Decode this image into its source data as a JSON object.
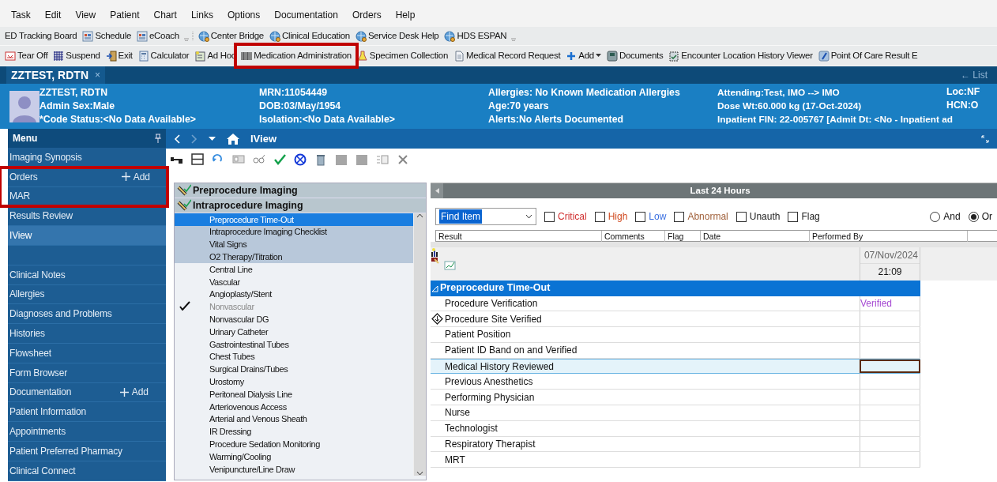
{
  "menu_bar": [
    "Task",
    "Edit",
    "View",
    "Patient",
    "Chart",
    "Links",
    "Options",
    "Documentation",
    "Orders",
    "Help"
  ],
  "toolbar_1": [
    {
      "label": "ED Tracking Board"
    },
    {
      "label": "Schedule"
    },
    {
      "label": "eCoach"
    },
    {
      "label": "Center Bridge"
    },
    {
      "label": "Clinical Education"
    },
    {
      "label": "Service Desk Help"
    },
    {
      "label": "HDS ESPAN"
    }
  ],
  "toolbar_2": [
    {
      "label": "Tear Off"
    },
    {
      "label": "Suspend"
    },
    {
      "label": "Exit"
    },
    {
      "label": "Calculator"
    },
    {
      "label": "Ad Hoc"
    },
    {
      "label": "Medication Administration",
      "highlighted": true
    },
    {
      "label": "Specimen Collection"
    },
    {
      "label": "Medical Record Request"
    },
    {
      "label": "Add"
    },
    {
      "label": "Documents"
    },
    {
      "label": "Encounter Location History Viewer"
    },
    {
      "label": "Point Of Care Result E"
    }
  ],
  "patient_tab": {
    "label": "ZZTEST, RDTN",
    "close": "×"
  },
  "list_button": {
    "arrow": "←",
    "label": "List"
  },
  "banner": [
    [
      "ZZTEST, RDTN",
      "Admin Sex:Male",
      "*Code Status:<No Data Available>"
    ],
    [
      "MRN:11054449",
      "DOB:03/May/1954",
      "Isolation:<No Data Available>"
    ],
    [
      "Allergies: No Known Medication Allergies",
      "Age:70 years",
      "Alerts:No Alerts Documented"
    ],
    [
      "Attending:Test, IMO --> IMO",
      "Dose Wt:60.000 kg (17-Oct-2024)",
      "Inpatient FIN: 22-005767 [Admit Dt: <No - Inpatient ad"
    ],
    [
      "Loc:NF",
      "HCN:O"
    ]
  ],
  "menu": {
    "title": "Menu",
    "items": [
      {
        "label": "Imaging Synopsis",
        "selected": false
      },
      {
        "label": "Orders",
        "add": "Add",
        "selected": false,
        "highlighted": true
      },
      {
        "label": "MAR",
        "selected": false,
        "highlighted": true
      },
      {
        "label": "Results Review",
        "selected": false
      },
      {
        "label": "IView",
        "selected": true,
        "spacer_after": true
      },
      {
        "label": "Clinical Notes",
        "selected": false
      },
      {
        "label": "Allergies",
        "selected": false
      },
      {
        "label": "Diagnoses and Problems",
        "selected": false
      },
      {
        "label": "Histories",
        "selected": false
      },
      {
        "label": "Flowsheet",
        "selected": false
      },
      {
        "label": "Form Browser",
        "selected": false
      },
      {
        "label": "Documentation",
        "add": "Add",
        "selected": false
      },
      {
        "label": "Patient Information",
        "selected": false
      },
      {
        "label": "Appointments",
        "selected": false
      },
      {
        "label": "Patient Preferred Pharmacy",
        "selected": false
      },
      {
        "label": "Clinical Connect",
        "selected": false
      }
    ]
  },
  "view_title": "IView",
  "bands": [
    {
      "label": "Preprocedure Imaging"
    },
    {
      "label": "Intraprocedure Imaging",
      "items": [
        {
          "label": "Preprocedure Time-Out",
          "selected": true,
          "in_view": true,
          "checked": false,
          "disabled": false
        },
        {
          "label": "Intraprocedure Imaging Checklist",
          "selected": false,
          "in_view": true,
          "checked": false,
          "disabled": false
        },
        {
          "label": "Vital Signs",
          "selected": false,
          "in_view": true,
          "checked": false,
          "disabled": false
        },
        {
          "label": "O2 Therapy/Titration",
          "selected": false,
          "in_view": true,
          "checked": false,
          "disabled": false
        },
        {
          "label": "Central Line",
          "selected": false,
          "in_view": false,
          "checked": false,
          "disabled": false
        },
        {
          "label": "Vascular",
          "selected": false,
          "in_view": false,
          "checked": false,
          "disabled": false
        },
        {
          "label": "Angioplasty/Stent",
          "selected": false,
          "in_view": false,
          "checked": false,
          "disabled": false
        },
        {
          "label": "Nonvascular",
          "selected": false,
          "in_view": false,
          "checked": true,
          "disabled": true
        },
        {
          "label": "Nonvascular DG",
          "selected": false,
          "in_view": false,
          "checked": false,
          "disabled": false
        },
        {
          "label": "Urinary Catheter",
          "selected": false,
          "in_view": false,
          "checked": false,
          "disabled": false
        },
        {
          "label": "Gastrointestinal Tubes",
          "selected": false,
          "in_view": false,
          "checked": false,
          "disabled": false
        },
        {
          "label": "Chest Tubes",
          "selected": false,
          "in_view": false,
          "checked": false,
          "disabled": false
        },
        {
          "label": "Surgical Drains/Tubes",
          "selected": false,
          "in_view": false,
          "checked": false,
          "disabled": false
        },
        {
          "label": "Urostomy",
          "selected": false,
          "in_view": false,
          "checked": false,
          "disabled": false
        },
        {
          "label": "Peritoneal Dialysis Line",
          "selected": false,
          "in_view": false,
          "checked": false,
          "disabled": false
        },
        {
          "label": "Arteriovenous Access",
          "selected": false,
          "in_view": false,
          "checked": false,
          "disabled": false
        },
        {
          "label": "Arterial and Venous Sheath",
          "selected": false,
          "in_view": false,
          "checked": false,
          "disabled": false
        },
        {
          "label": "IR Dressing",
          "selected": false,
          "in_view": false,
          "checked": false,
          "disabled": false
        },
        {
          "label": "Procedure Sedation Monitoring",
          "selected": false,
          "in_view": false,
          "checked": false,
          "disabled": false
        },
        {
          "label": "Warming/Cooling",
          "selected": false,
          "in_view": false,
          "checked": false,
          "disabled": false
        },
        {
          "label": "Venipuncture/Line Draw",
          "selected": false,
          "in_view": false,
          "checked": false,
          "disabled": false
        }
      ]
    }
  ],
  "results": {
    "range_title": "Last 24 Hours",
    "find": {
      "value": "Find Item"
    },
    "filters": [
      {
        "label": "Critical",
        "checked": false,
        "color": "#d03030"
      },
      {
        "label": "High",
        "checked": false,
        "color": "#d04a20"
      },
      {
        "label": "Low",
        "checked": false,
        "color": "#3a6fe0"
      },
      {
        "label": "Abnormal",
        "checked": false,
        "color": "#a0603a"
      },
      {
        "label": "Unauth",
        "checked": false,
        "color": "#222222"
      },
      {
        "label": "Flag",
        "checked": false,
        "color": "#222222"
      }
    ],
    "logic": [
      {
        "label": "And",
        "selected": false
      },
      {
        "label": "Or",
        "selected": true
      }
    ],
    "columns": [
      "Result",
      "Comments",
      "Flag",
      "Date",
      "Performed By"
    ]
  },
  "grid": {
    "date": "07/Nov/2024",
    "time": "21:09",
    "section": {
      "label": "Preprocedure Time-Out",
      "expanded": true
    },
    "rows": [
      {
        "label": "Procedure Verification",
        "value": "Verified",
        "kind": "plain",
        "selected": false
      },
      {
        "label": "Procedure Site Verified",
        "kind": "reference",
        "selected": false
      },
      {
        "label": "Patient Position",
        "kind": "plain",
        "selected": false
      },
      {
        "label": "Patient ID Band on and Verified",
        "kind": "plain",
        "selected": false
      },
      {
        "label": "Medical History Reviewed",
        "kind": "plain",
        "selected": true
      },
      {
        "label": "Previous Anesthetics",
        "kind": "plain",
        "selected": false
      },
      {
        "label": "Performing Physician",
        "kind": "plain",
        "selected": false
      },
      {
        "label": "Nurse",
        "kind": "plain",
        "selected": false
      },
      {
        "label": "Technologist",
        "kind": "plain",
        "selected": false
      },
      {
        "label": "Respiratory Therapist",
        "kind": "plain",
        "selected": false
      },
      {
        "label": "MRT",
        "kind": "plain",
        "selected": false
      }
    ]
  }
}
